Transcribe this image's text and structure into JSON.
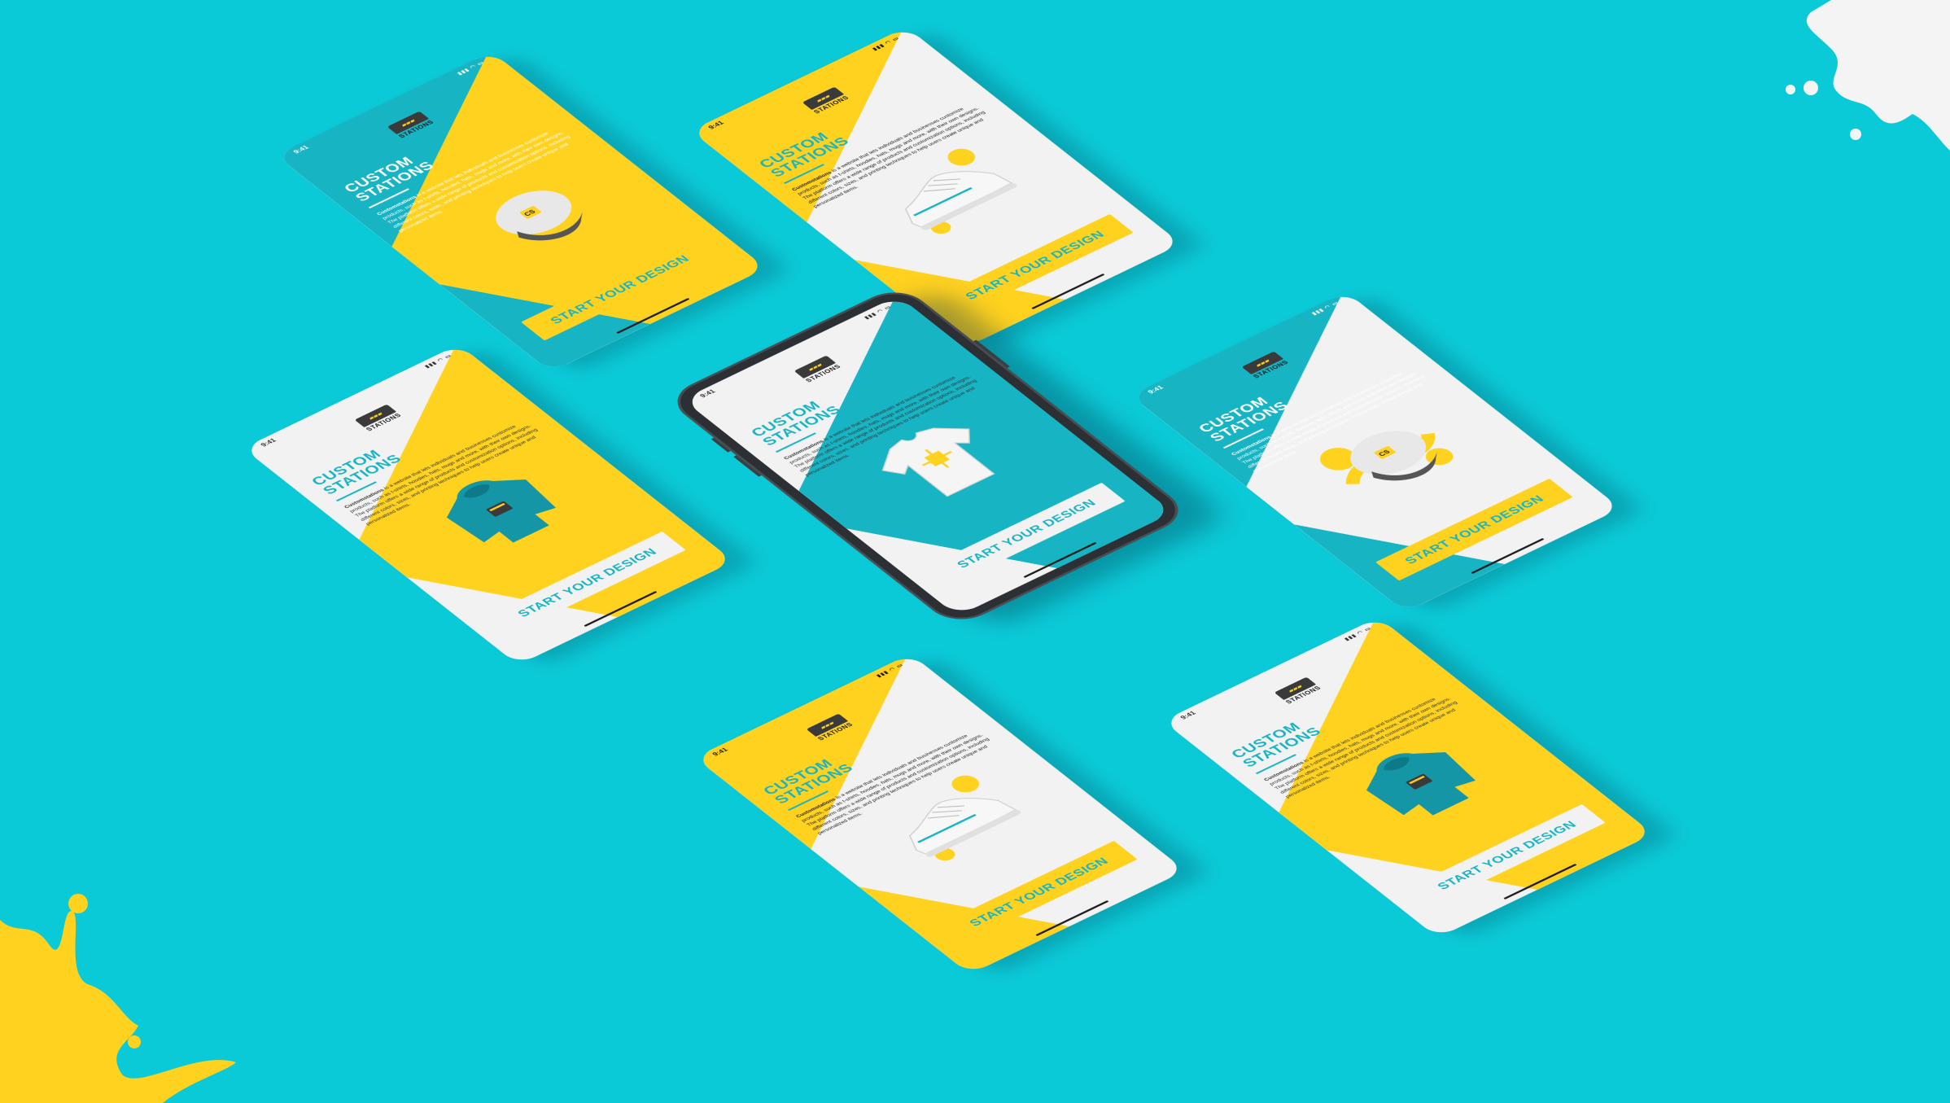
{
  "colors": {
    "background": "#0bcad8",
    "teal": "#17b4c4",
    "yellow": "#ffd21f",
    "white": "#f2f2f2",
    "dark": "#1c1c1c"
  },
  "screens": [
    {
      "time": "9:41",
      "title": "CUSTOM STATIONS",
      "desc_bold": "Customstations",
      "desc": " is a website that lets individuals and businesses customize products, such as t-shirts, hoodies, hats, mugs and more, with their own designs. The platform offers a wide range of products and customization options, including different colors, sizes, and printing techniques to help users create unique and personalized items.",
      "cta": "START YOUR DESIGN",
      "product_icon": "cap-icon",
      "logo_text": "STATIONS"
    }
  ]
}
